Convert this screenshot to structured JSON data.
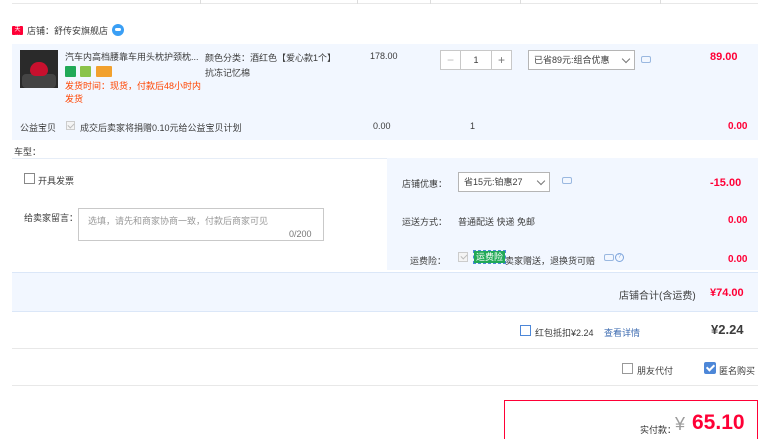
{
  "shop": {
    "label": "店铺：",
    "name": "舒传安旗舰店",
    "badge": "天猫"
  },
  "item": {
    "title": "汽车内高档腰靠车用头枕护颈枕...",
    "sku_line1": "颜色分类：酒红色【爱心款1个】",
    "sku_line2": "抗冻记忆棉",
    "ship_time": "发货时间：现货，付款后48小时内发货",
    "unit_price": "178.00",
    "quantity": "1",
    "qty_minus": "−",
    "qty_plus": "+",
    "promo_selected": "已省89元:组合优惠",
    "total": "89.00"
  },
  "charity": {
    "label": "公益宝贝",
    "text": "成交后卖家将捐赠0.10元给公益宝贝计划",
    "price": "0.00",
    "qty": "1",
    "total": "0.00"
  },
  "car_label": "车型：",
  "invoice": {
    "label": "开具发票"
  },
  "message": {
    "label": "给卖家留言：",
    "placeholder": "选填，请先和商家协商一致，付款后商家可见",
    "count": "0/200"
  },
  "shop_discount": {
    "label": "店铺优惠：",
    "selected": "省15元:铂惠27",
    "value": "-15.00"
  },
  "shipping": {
    "label": "运送方式：",
    "method": "普通配送 快递 免邮",
    "value": "0.00"
  },
  "insurance": {
    "label": "运费险：",
    "badge": "运费险",
    "text": "卖家赠送，退换货可赔",
    "value": "0.00"
  },
  "shop_total": {
    "label": "店铺合计(含运费)",
    "value": "¥74.00"
  },
  "red_packet": {
    "text": "红包抵扣¥2.24",
    "detail": "查看详情",
    "value": "¥2.24"
  },
  "options": {
    "friend_pay": "朋友代付",
    "anonymous": "匿名购买"
  },
  "payment": {
    "label": "实付款：",
    "currency": "¥",
    "amount": "65.10"
  },
  "colors": {
    "price_red": "#ff0036",
    "panel_blue": "#f2f7ff",
    "checkbox_blue": "#4d87d8"
  }
}
